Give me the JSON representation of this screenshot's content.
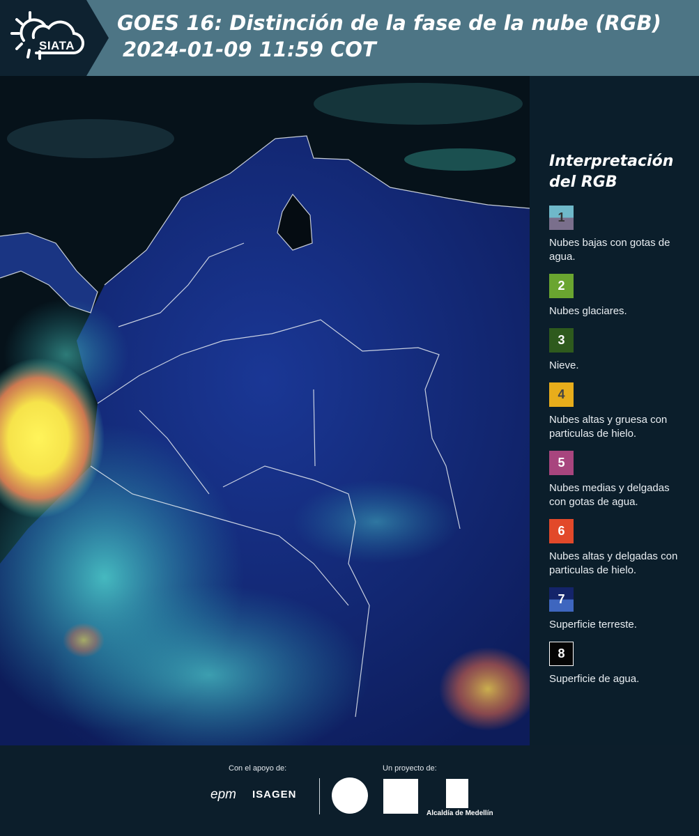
{
  "header": {
    "logo_text": "SIATA",
    "title_line1": "GOES 16: Distinción de la fase de la nube (RGB)",
    "title_line2": "2024-01-09 11:59 COT"
  },
  "legend": {
    "title": "Interpretación del RGB",
    "items": [
      {
        "number": "1",
        "label": "Nubes bajas con gotas de agua.",
        "color_top": "#6fb8c9",
        "color_bottom": "#7a6f8c",
        "text_color": "#333333"
      },
      {
        "number": "2",
        "label": "Nubes glaciares.",
        "color_top": "#6aa530",
        "color_bottom": "#6aa530",
        "text_color": "#ffffff"
      },
      {
        "number": "3",
        "label": "Nieve.",
        "color_top": "#2e5a1d",
        "color_bottom": "#2e5a1d",
        "text_color": "#ffffff"
      },
      {
        "number": "4",
        "label": "Nubes altas y gruesa con particulas de hielo.",
        "color_top": "#e8ad1b",
        "color_bottom": "#e8ad1b",
        "text_color": "#444444"
      },
      {
        "number": "5",
        "label": "Nubes medias y delgadas con gotas de agua.",
        "color_top": "#a8457e",
        "color_bottom": "#a8457e",
        "text_color": "#ffffff"
      },
      {
        "number": "6",
        "label": "Nubes altas y delgadas con particulas de hielo.",
        "color_top": "#e2492a",
        "color_bottom": "#e2492a",
        "text_color": "#ffffff"
      },
      {
        "number": "7",
        "label": "Superficie terreste.",
        "color_top": "#14246a",
        "color_bottom": "#3e66bf",
        "text_color": "#ffffff"
      },
      {
        "number": "8",
        "label": "Superficie de agua.",
        "color_top": "#050505",
        "color_bottom": "#050505",
        "text_color": "#ffffff"
      }
    ]
  },
  "footer": {
    "support_caption": "Con el apoyo de:",
    "project_caption": "Un proyecto de:",
    "epm": "epm",
    "isagen": "ISAGEN",
    "alcaldia": "Alcaldía de Medellín"
  }
}
